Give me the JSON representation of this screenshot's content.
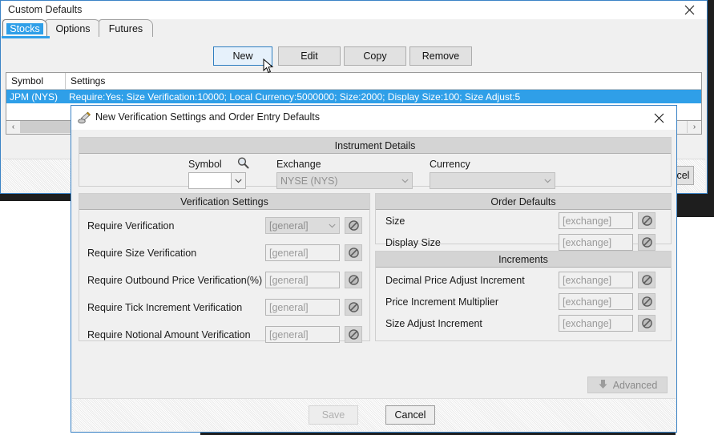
{
  "main_window": {
    "title": "Custom Defaults",
    "close_icon": "close-icon",
    "tabs": [
      {
        "label": "Stocks",
        "selected": true
      },
      {
        "label": "Options",
        "selected": false
      },
      {
        "label": "Futures",
        "selected": false
      }
    ],
    "toolbar_buttons": [
      {
        "label": "New",
        "focused": true
      },
      {
        "label": "Edit",
        "focused": false
      },
      {
        "label": "Copy",
        "focused": false
      },
      {
        "label": "Remove",
        "focused": false
      }
    ],
    "grid": {
      "columns": [
        "Symbol",
        "Settings"
      ],
      "rows": [
        {
          "symbol": "JPM (NYS)",
          "settings": "Require:Yes; Size Verification:10000; Local Currency:5000000; Size:2000; Display Size:100; Size Adjust:5",
          "selected": true
        }
      ]
    },
    "scrollbar": {
      "left_arrow": "‹",
      "right_arrow": "›"
    },
    "footer": {
      "cancel_label": "Cancel"
    }
  },
  "dialog": {
    "title": "New Verification Settings and Order Entry Defaults",
    "title_icon": "stamp-icon",
    "close_icon": "close-icon",
    "instrument_details": {
      "caption": "Instrument Details",
      "symbol": {
        "label": "Symbol",
        "value": "",
        "search_icon": "search-icon"
      },
      "exchange": {
        "label": "Exchange",
        "value": "NYSE (NYS)"
      },
      "currency": {
        "label": "Currency",
        "value": ""
      }
    },
    "verification_settings": {
      "caption": "Verification Settings",
      "fields": [
        {
          "label": "Require Verification",
          "value": "[general]",
          "type": "combo",
          "reset_icon": "no-entry-icon"
        },
        {
          "label": "Require Size Verification",
          "value": "[general]",
          "type": "text",
          "reset_icon": "no-entry-icon"
        },
        {
          "label": "Require Outbound Price Verification(%)",
          "value": "[general]",
          "type": "text",
          "reset_icon": "no-entry-icon"
        },
        {
          "label": "Require Tick Increment Verification",
          "value": "[general]",
          "type": "text",
          "reset_icon": "no-entry-icon"
        },
        {
          "label": "Require Notional Amount Verification",
          "value": "[general]",
          "type": "text",
          "reset_icon": "no-entry-icon"
        }
      ]
    },
    "order_defaults": {
      "caption": "Order Defaults",
      "fields": [
        {
          "label": "Size",
          "value": "[exchange]",
          "reset_icon": "no-entry-icon"
        },
        {
          "label": "Display Size",
          "value": "[exchange]",
          "reset_icon": "no-entry-icon"
        }
      ]
    },
    "increments": {
      "caption": "Increments",
      "fields": [
        {
          "label": "Decimal Price Adjust Increment",
          "value": "[exchange]",
          "reset_icon": "no-entry-icon"
        },
        {
          "label": "Price Increment Multiplier",
          "value": "[exchange]",
          "reset_icon": "no-entry-icon"
        },
        {
          "label": "Size Adjust Increment",
          "value": "[exchange]",
          "reset_icon": "no-entry-icon"
        }
      ]
    },
    "advanced_button": {
      "label": "Advanced",
      "icon": "arrow-down-icon",
      "enabled": false
    },
    "footer": {
      "save_label": "Save",
      "save_enabled": false,
      "cancel_label": "Cancel"
    }
  },
  "colors": {
    "accent": "#2f9fe8",
    "window_border": "#3b83c6",
    "desktop": "#1e1e1e",
    "panel": "#f0f0f0",
    "caption_bar": "#d4d4d4"
  }
}
